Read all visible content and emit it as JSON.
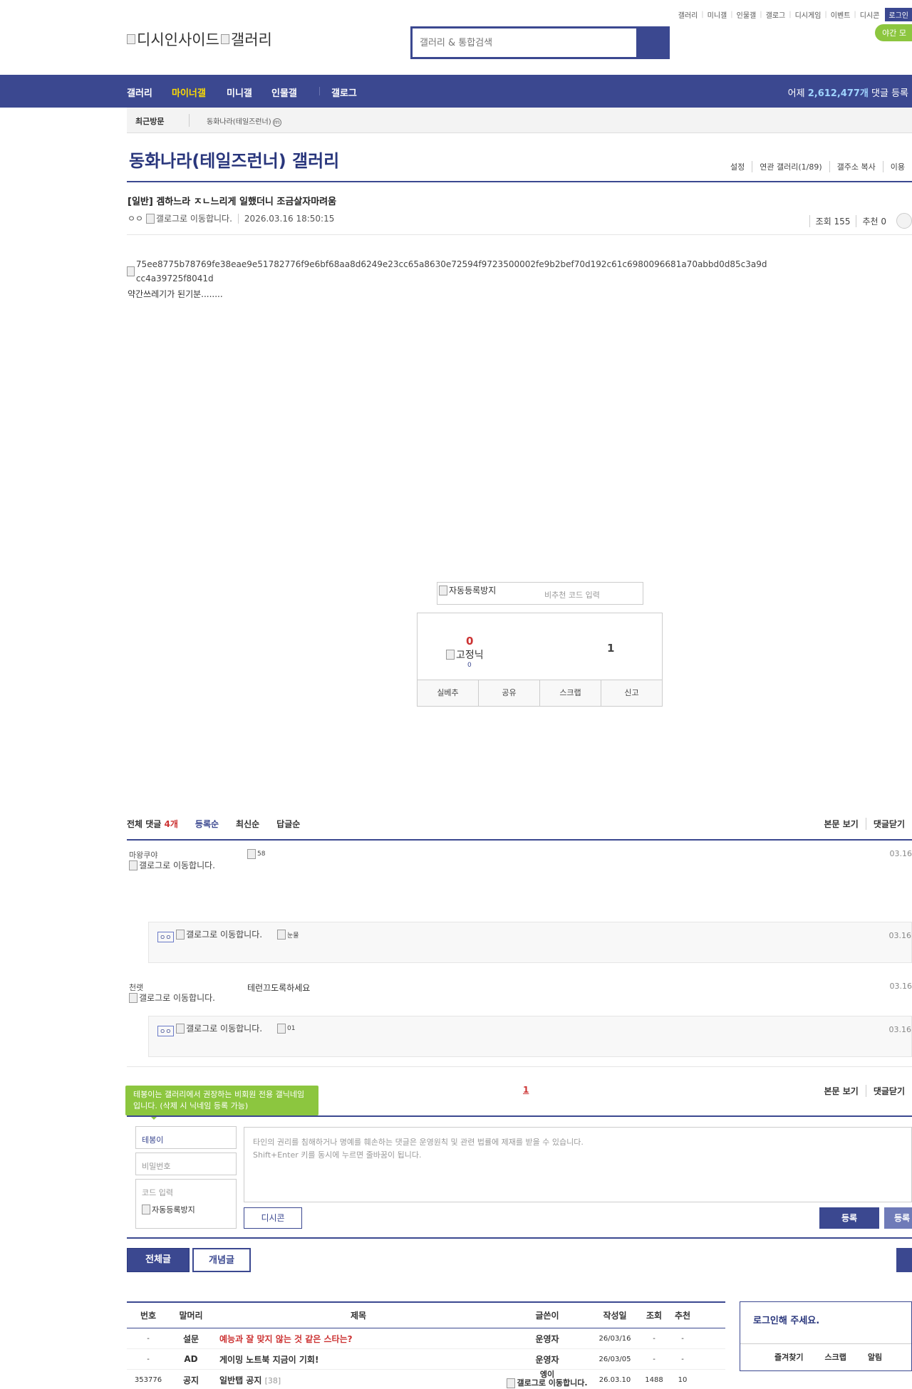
{
  "top_util": {
    "links": [
      "갤러리",
      "미니갤",
      "인물갤",
      "갤로그",
      "디시게임",
      "이벤트",
      "디시콘"
    ],
    "login": "로그인",
    "night_mode": "야간 모"
  },
  "logo": {
    "alt1": "디시인사이드",
    "alt2": "갤러리"
  },
  "search": {
    "placeholder": "갤러리 & 통합검색"
  },
  "gnb": {
    "items": [
      "갤러리",
      "마이너갤",
      "미니갤",
      "인물갤",
      "갤로그"
    ],
    "stats_prefix": "어제",
    "stats_count": "2,612,477개",
    "stats_suffix": "댓글 등록"
  },
  "recent": {
    "label": "최근방문",
    "item": "동화나라(테일즈런너)",
    "item_badge": "m"
  },
  "gallery": {
    "title": "동화나라(테일즈런너) 갤러리",
    "links": [
      "설정",
      "연관 갤러리(1/89)",
      "갤주소 복사",
      "이용"
    ]
  },
  "post": {
    "title": "[일반] 겜하느라 ㅈㄴ느리게 일했더니 조금살자마려움",
    "author": "ㅇㅇ",
    "gallog_alt": "갤로그로 이동합니다.",
    "date": "2026.03.16 18:50:15",
    "views": "조회 155",
    "recommend": "추천 0",
    "image_alt": "75ee8775b78769fe38eae9e51782776f9e6bf68aa8d6249e23cc65a8630e72594f9723500002fe9b2bef70d192c61c6980096681a70abbd0d85c3a9dcc4a39725f8041d",
    "body": "약간쓰레기가 된기분........"
  },
  "captcha": {
    "alt": "자동등록방지",
    "placeholder": "비추천 코드 입력"
  },
  "recommend_box": {
    "up_count": "0",
    "fixed_alt": "고정닉",
    "fixed_count": "0",
    "down_count": "1",
    "buttons": [
      "실베추",
      "공유",
      "스크랩",
      "신고"
    ]
  },
  "comments": {
    "total_label": "전체 댓글",
    "total_count": "4개",
    "sort_tabs": [
      "등록순",
      "최신순",
      "답글순"
    ],
    "right_links": [
      "본문 보기",
      "댓글닫기"
    ],
    "items": [
      {
        "nick": "마왕쿠야",
        "gallog_alt": "갤로그로 이동합니다.",
        "dccon_alt": "58",
        "date": "03.16",
        "text": ""
      },
      {
        "nick": "ㅇㅇ",
        "gallog_alt": "갤로그로 이동합니다.",
        "dccon_alt": "눈물",
        "date": "03.16",
        "text": ""
      },
      {
        "nick": "천랫",
        "gallog_alt": "갤로그로 이동합니다.",
        "dccon_alt": "",
        "date": "03.16",
        "text": "테런끄도록하세요"
      },
      {
        "nick": "ㅇㅇ",
        "gallog_alt": "갤로그로 이동합니다.",
        "dccon_alt": "01",
        "date": "03.16",
        "text": ""
      }
    ],
    "page": "1"
  },
  "write": {
    "tooltip": "테봉이는 갤러리에서 권장하는 비회원 전용 갤닉네임입니다. (삭제 시 닉네임 등록 가능)",
    "name_value": "테봉이",
    "password_placeholder": "비밀번호",
    "code_placeholder": "코드 입력",
    "captcha_alt": "자동등록방지",
    "textarea_line1": "타인의 권리를 침해하거나 명예를 훼손하는 댓글은 운영원칙 및 관련 법률에 제재를 받을 수 있습니다.",
    "textarea_line2": "Shift+Enter 키를 동시에 누르면 줄바꿈이 됩니다.",
    "dccon": "디시콘",
    "submit": "등록",
    "submit2": "등록"
  },
  "list_buttons": {
    "all": "전체글",
    "concept": "개념글"
  },
  "list": {
    "headers": [
      "번호",
      "말머리",
      "제목",
      "글쓴이",
      "작성일",
      "조회",
      "추천"
    ],
    "rows": [
      {
        "no": "-",
        "head": "설문",
        "title": "예능과 잘 맞지 않는 것 같은 스타는?",
        "writer": "운영자",
        "date": "26/03/16",
        "views": "-",
        "rec": "-"
      },
      {
        "no": "-",
        "head": "AD",
        "title": "게이밍 노트북 지금이 기회!",
        "writer": "운영자",
        "date": "26/03/05",
        "views": "-",
        "rec": "-"
      },
      {
        "no": "353776",
        "head": "공지",
        "title": "일반탭 공지",
        "count": "[38]",
        "writer": "엥이",
        "writer_alt": "갤로그로 이동합니다.",
        "date": "26.03.10",
        "views": "1488",
        "rec": "10"
      }
    ]
  },
  "login_box": {
    "message": "로그인해 주세요.",
    "links": [
      "즐겨찾기",
      "스크랩",
      "알림"
    ]
  },
  "colors": {
    "brand": "#3b4890",
    "accent_green": "#8cc63f",
    "highlight_yellow": "#ffdd00",
    "red": "#cc3333"
  }
}
